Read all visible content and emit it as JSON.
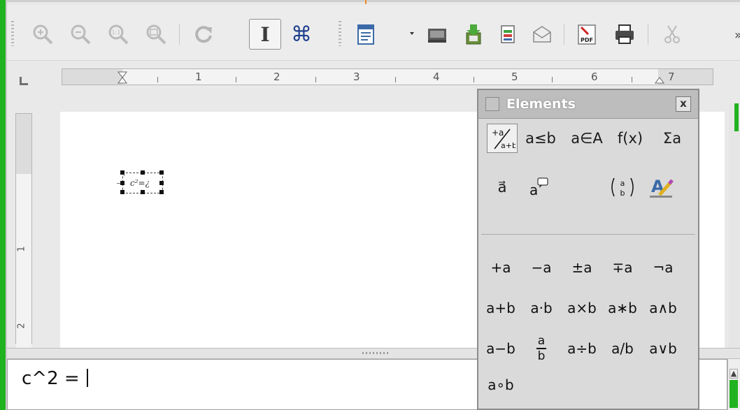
{
  "colors": {
    "accent": "#21b21f",
    "active_tick": "#f08a2c",
    "panel_title_bg": "#bdbdbd"
  },
  "toolbar": {
    "buttons": [
      {
        "icon": "zoom-in-icon",
        "state": "disabled"
      },
      {
        "icon": "zoom-out-icon",
        "state": "disabled"
      },
      {
        "icon": "zoom-100-icon",
        "state": "disabled",
        "label": "1:1"
      },
      {
        "icon": "show-all-icon",
        "state": "disabled"
      },
      {
        "icon": "update-icon",
        "state": "disabled"
      },
      {
        "icon": "formula-cursor-icon",
        "state": "active",
        "label": "I"
      },
      {
        "icon": "symbols-icon",
        "state": "normal",
        "label": "⌘"
      },
      {
        "icon": "document-icon",
        "state": "normal"
      },
      {
        "icon": "folder-icon",
        "state": "normal"
      },
      {
        "icon": "save-icon",
        "state": "normal"
      },
      {
        "icon": "edit-file-icon",
        "state": "normal"
      },
      {
        "icon": "email-icon",
        "state": "normal"
      },
      {
        "icon": "export-pdf-icon",
        "state": "normal",
        "label": "PDF"
      },
      {
        "icon": "print-icon",
        "state": "normal"
      },
      {
        "icon": "cut-icon",
        "state": "disabled"
      }
    ],
    "more": "»"
  },
  "ruler": {
    "h_numbers": [
      "1",
      "2",
      "3",
      "4",
      "5",
      "6",
      "7"
    ],
    "v_numbers": [
      "1",
      "2"
    ]
  },
  "document": {
    "formula": "c²=¿"
  },
  "command": {
    "text": "c^2 = "
  },
  "elements_panel": {
    "title": "Elements",
    "close": "x",
    "categories": [
      {
        "name": "unary-binary",
        "label": "+a⁄a+b"
      },
      {
        "name": "relations",
        "label": "a≤b"
      },
      {
        "name": "set-operations",
        "label": "a∈A"
      },
      {
        "name": "functions",
        "label": "f(x)"
      },
      {
        "name": "operators",
        "label": "Σa"
      },
      {
        "name": "attributes",
        "label": "a⃗"
      },
      {
        "name": "others",
        "label": "a"
      },
      {
        "name": "brackets",
        "label": "(a b)"
      },
      {
        "name": "formats",
        "label": "format"
      }
    ],
    "rows": [
      [
        "+a",
        "−a",
        "±a",
        "∓a",
        "¬a"
      ],
      [
        "a+b",
        "a·b",
        "a×b",
        "a∗b",
        "a∧b"
      ],
      [
        "a−b",
        "a/b-frac",
        "a÷b",
        "a/b",
        "a∨b"
      ],
      [
        "a∘b"
      ]
    ],
    "frac_top": "a",
    "frac_bottom": "b"
  }
}
